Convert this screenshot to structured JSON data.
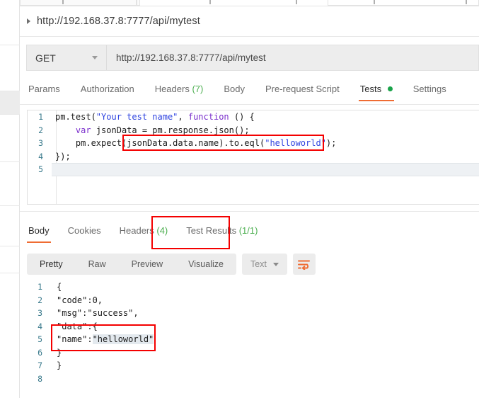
{
  "app": "Postman",
  "tab_strip": {
    "tabs": [
      {
        "label": "",
        "active": false
      },
      {
        "label": "",
        "active": false
      },
      {
        "label": "",
        "active": true
      }
    ]
  },
  "breadcrumb": {
    "caret_icon": "caret-right-icon",
    "text": "http://192.168.37.8:7777/api/mytest"
  },
  "url_bar": {
    "method": "GET",
    "method_caret_icon": "chevron-down-icon",
    "url": "http://192.168.37.8:7777/api/mytest"
  },
  "request_tabs": [
    {
      "label": "Params",
      "count": "",
      "active": false,
      "dot": false
    },
    {
      "label": "Authorization",
      "count": "",
      "active": false,
      "dot": false
    },
    {
      "label": "Headers",
      "count": "(7)",
      "active": false,
      "dot": false
    },
    {
      "label": "Body",
      "count": "",
      "active": false,
      "dot": false
    },
    {
      "label": "Pre-request Script",
      "count": "",
      "active": false,
      "dot": false
    },
    {
      "label": "Tests",
      "count": "",
      "active": true,
      "dot": true
    },
    {
      "label": "Settings",
      "count": "",
      "active": false,
      "dot": false
    }
  ],
  "script_editor": {
    "lines": [
      {
        "number": "1",
        "tokens": [
          {
            "t": "pm.test(",
            "c": "plain"
          },
          {
            "t": "\"Your test name\"",
            "c": "str"
          },
          {
            "t": ", ",
            "c": "plain"
          },
          {
            "t": "function",
            "c": "kw"
          },
          {
            "t": " () {",
            "c": "plain"
          }
        ]
      },
      {
        "number": "2",
        "tokens": [
          {
            "t": "    ",
            "c": "plain"
          },
          {
            "t": "var",
            "c": "kw"
          },
          {
            "t": " jsonData = pm.response.json();",
            "c": "plain"
          }
        ]
      },
      {
        "number": "3",
        "tokens": [
          {
            "t": "    pm.expect(jsonData.data.name).to.eql(",
            "c": "plain"
          },
          {
            "t": "\"helloworld\"",
            "c": "str"
          },
          {
            "t": ");",
            "c": "plain"
          }
        ]
      },
      {
        "number": "4",
        "tokens": [
          {
            "t": "});",
            "c": "plain"
          }
        ]
      },
      {
        "number": "5",
        "tokens": [],
        "active": true
      }
    ]
  },
  "response_tabs": [
    {
      "label": "Body",
      "count": "",
      "active": true
    },
    {
      "label": "Cookies",
      "count": "",
      "active": false
    },
    {
      "label": "Headers",
      "count": "(4)",
      "active": false
    },
    {
      "label": "Test Results",
      "count": "(1/1)",
      "active": false
    }
  ],
  "response_toolbar": {
    "formats": [
      {
        "label": "Pretty",
        "active": true
      },
      {
        "label": "Raw",
        "active": false
      },
      {
        "label": "Preview",
        "active": false
      },
      {
        "label": "Visualize",
        "active": false
      }
    ],
    "type": "Text",
    "type_caret_icon": "chevron-down-icon",
    "wrap_icon": "wrap-text-icon"
  },
  "response_body": {
    "lines": [
      {
        "number": "1",
        "text": "{"
      },
      {
        "number": "2",
        "text": "\"code\":0,"
      },
      {
        "number": "3",
        "text": "\"msg\":\"success\","
      },
      {
        "number": "4",
        "text": "\"data\":{"
      },
      {
        "number": "5",
        "text": "\"name\":",
        "highlight": "\"helloworld\""
      },
      {
        "number": "6",
        "text": "}"
      },
      {
        "number": "7",
        "text": "}"
      },
      {
        "number": "8",
        "text": ""
      }
    ]
  },
  "annotations": {
    "color": "#f40000",
    "boxes": [
      {
        "name": "expect-assertion-highlight"
      },
      {
        "name": "test-results-tab-highlight"
      },
      {
        "name": "response-data-name-highlight"
      }
    ]
  }
}
